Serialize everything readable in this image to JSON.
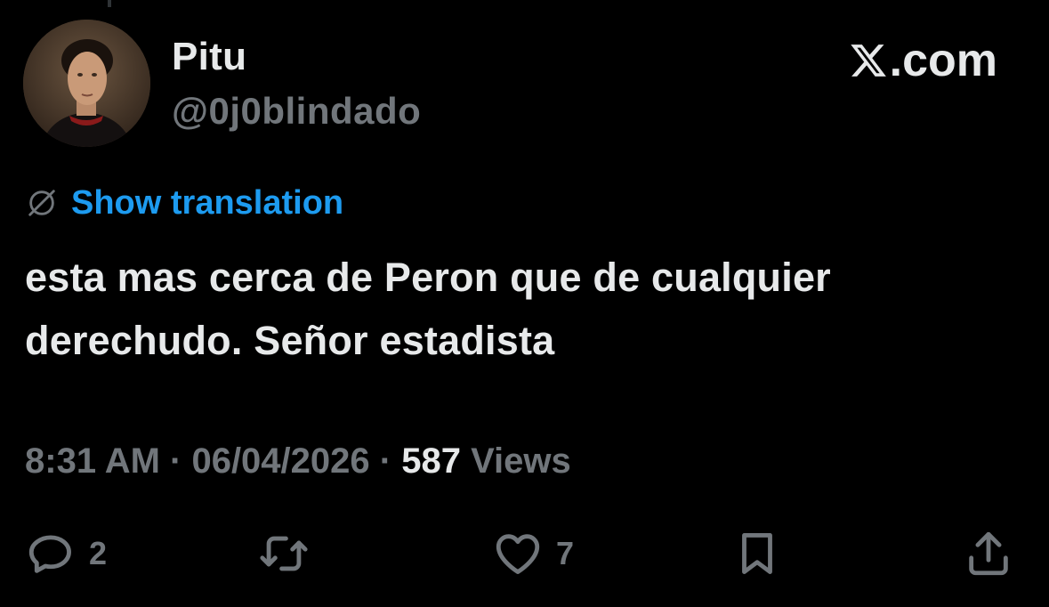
{
  "author": {
    "display_name": "Pitu",
    "handle": "@0j0blindado"
  },
  "source": {
    "label": ".com",
    "logo_icon": "x-logo-icon"
  },
  "translation": {
    "icon": "globe-icon",
    "label": "Show translation"
  },
  "tweet": {
    "text": "esta mas cerca de Peron que de cualquier derechudo. Señor estadista"
  },
  "meta": {
    "time": "8:31 AM",
    "separator1": " · ",
    "date": "06/04/2026",
    "separator2": " · ",
    "views_count": "587",
    "views_label": " Views"
  },
  "actions": {
    "reply_count": "2",
    "like_count": "7"
  },
  "colors": {
    "background": "#000000",
    "primary_text": "#e7e9ea",
    "secondary_text": "#71767b",
    "accent": "#1d9bf0"
  }
}
